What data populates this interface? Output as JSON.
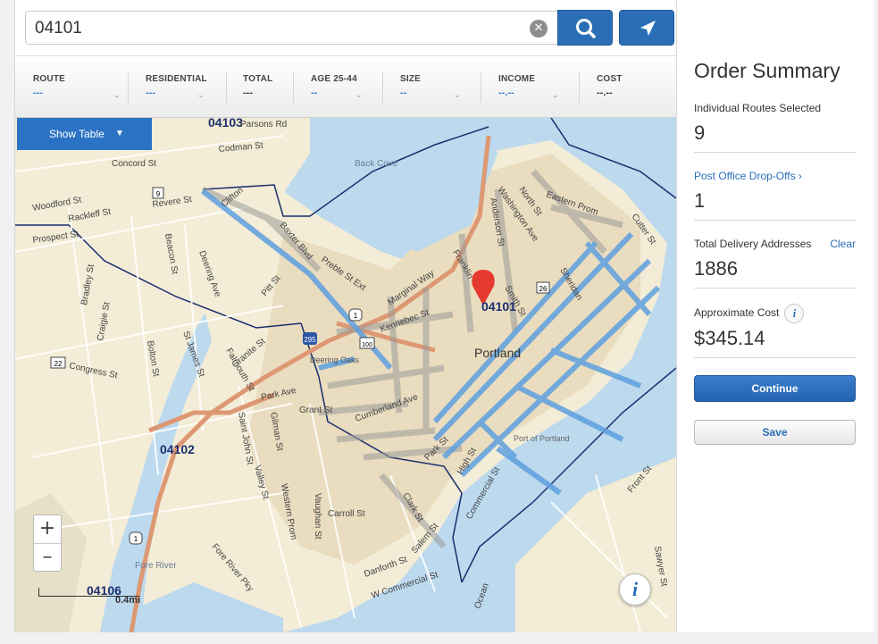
{
  "search": {
    "value": "04101",
    "clear_icon": "clear-icon",
    "search_icon": "search-icon",
    "locate_icon": "location-arrow-icon"
  },
  "filters": [
    {
      "label": "ROUTE",
      "value": "---"
    },
    {
      "label": "RESIDENTIAL",
      "value": "---"
    },
    {
      "label": "TOTAL",
      "value": "---"
    },
    {
      "label": "AGE 25-44",
      "value": "--"
    },
    {
      "label": "SIZE",
      "value": "--"
    },
    {
      "label": "INCOME",
      "value": "--.--"
    },
    {
      "label": "COST",
      "value": "--.--"
    }
  ],
  "map": {
    "show_table_label": "Show Table",
    "zoom_in": "+",
    "zoom_out": "–",
    "scale_label": "0.4mi",
    "info_label": "i",
    "zip_labels": [
      "04103",
      "04101",
      "04102",
      "04106"
    ],
    "place_labels": [
      "Portland",
      "Back Cove",
      "Deering Oaks",
      "Port of Portland",
      "Fore River"
    ],
    "street_labels": [
      "Parsons Rd",
      "Codman St",
      "Concord St",
      "Woodford St",
      "Rackleff St",
      "Revere St",
      "Prospect St",
      "Clifton",
      "Baxter Blvd",
      "Preble St Ext",
      "Marginal Way",
      "Franklin",
      "Washington Ave",
      "Anderson St",
      "North St",
      "Eastern Prom",
      "Cutter St",
      "Sheridan",
      "Smith St",
      "Kennebec St",
      "Congress St",
      "Bolton St",
      "Craigie St",
      "Bradley St",
      "St James St",
      "Falmouth St",
      "Granite St",
      "Park Ave",
      "Grant St",
      "Cumberland Ave",
      "Saint John St",
      "Gilman St",
      "Valley St",
      "Western Prom",
      "Vaughan St",
      "Carroll St",
      "Clark St",
      "Salem St",
      "High St",
      "Park St",
      "Commercial St",
      "Danforth St",
      "W Commercial St",
      "Fore River Pky",
      "Front St",
      "Sawyer St",
      "Pitt St",
      "Deering Ave",
      "Beacon St",
      "Ocean"
    ],
    "shield_labels": [
      "1",
      "295",
      "9",
      "22",
      "26",
      "100"
    ],
    "pin_icon": "map-pin-icon"
  },
  "summary": {
    "title": "Order Summary",
    "routes_label": "Individual Routes Selected",
    "routes_value": "9",
    "dropoffs_label": "Post Office Drop-Offs ›",
    "dropoffs_value": "1",
    "addresses_label": "Total Delivery Addresses",
    "addresses_clear": "Clear",
    "addresses_value": "1886",
    "cost_label": "Approximate Cost",
    "cost_info": "i",
    "cost_value": "$345.14",
    "continue_label": "Continue",
    "save_label": "Save"
  }
}
